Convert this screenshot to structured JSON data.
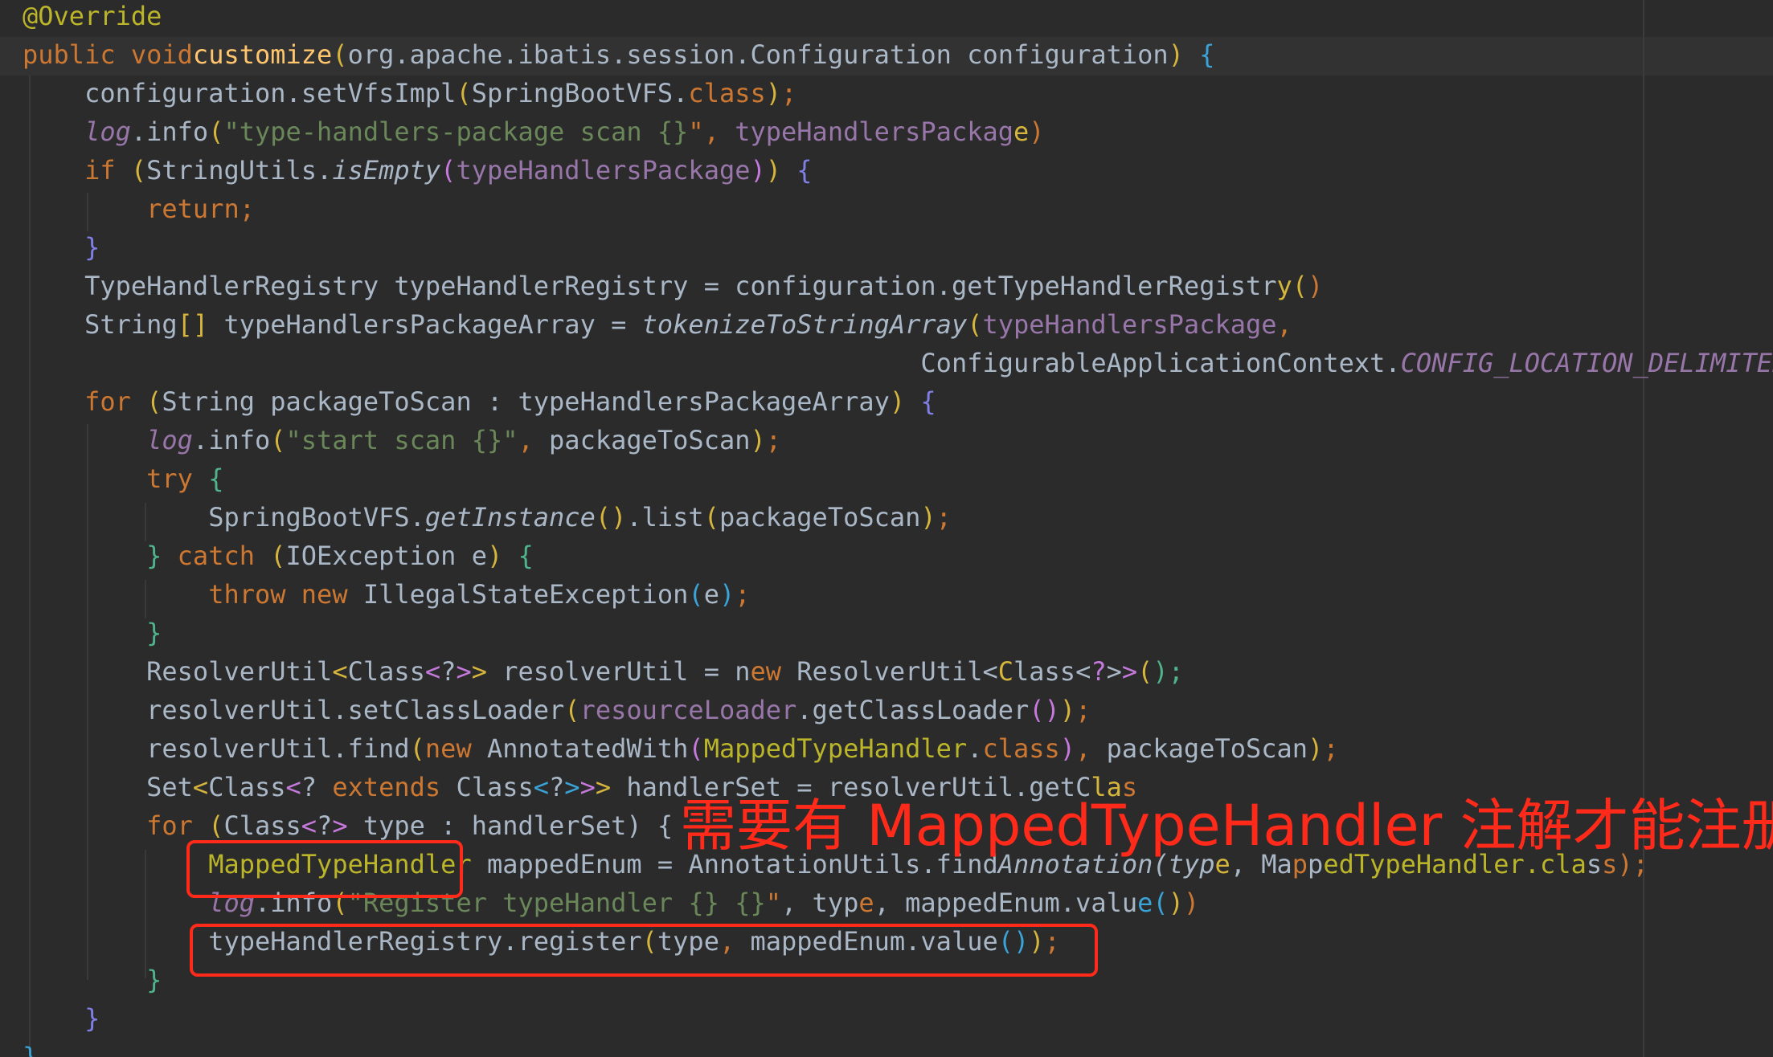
{
  "code_lines": [
    "@Override",
    "public void customize(org.apache.ibatis.session.Configuration configuration) {",
    "    configuration.setVfsImpl(SpringBootVFS.class);",
    "    log.info(\"type-handlers-package scan {}\", typeHandlersPackage);",
    "    if (StringUtils.isEmpty(typeHandlersPackage)) {",
    "        return;",
    "    }",
    "    TypeHandlerRegistry typeHandlerRegistry = configuration.getTypeHandlerRegistry();",
    "    String[] typeHandlersPackageArray = tokenizeToStringArray(typeHandlersPackage,",
    "                                                          ConfigurableApplicationContext.CONFIG_LOCATION_DELIMITERS);",
    "    for (String packageToScan : typeHandlersPackageArray) {",
    "        log.info(\"start scan {}\", packageToScan);",
    "        try {",
    "            SpringBootVFS.getInstance().list(packageToScan);",
    "        } catch (IOException e) {",
    "            throw new IllegalStateException(e);",
    "        }",
    "        ResolverUtil<Class<?>> resolverUtil = new ResolverUtil<Class<?>>();",
    "        resolverUtil.setClassLoader(resourceLoader.getClassLoader());",
    "        resolverUtil.find(new AnnotatedWith(MappedTypeHandler.class), packageToScan);",
    "        Set<Class<? extends Class<?>>> handlerSet = resolverUtil.getClasses();",
    "        for (Class<?> type : handlerSet) {",
    "            MappedTypeHandler mappedEnum = AnnotationUtils.findAnnotation(type, MappedTypeHandler.class);",
    "            log.info(\"Register typeHandler {} {}\", type, mappedEnum.value());",
    "            typeHandlerRegistry.register(type, mappedEnum.value());",
    "        }",
    "    }",
    "}"
  ],
  "annotation_note": "需要有 MappedTypeHandler 注解才能注册",
  "colors": {
    "background": "#2b2b2b",
    "keyword": "#cc7832",
    "string": "#6a8759",
    "field": "#9876aa",
    "method_decl": "#ffc66d",
    "annotation": "#bbb529",
    "plain": "#a9b7c6",
    "highlight_box": "#ff2a1a"
  }
}
